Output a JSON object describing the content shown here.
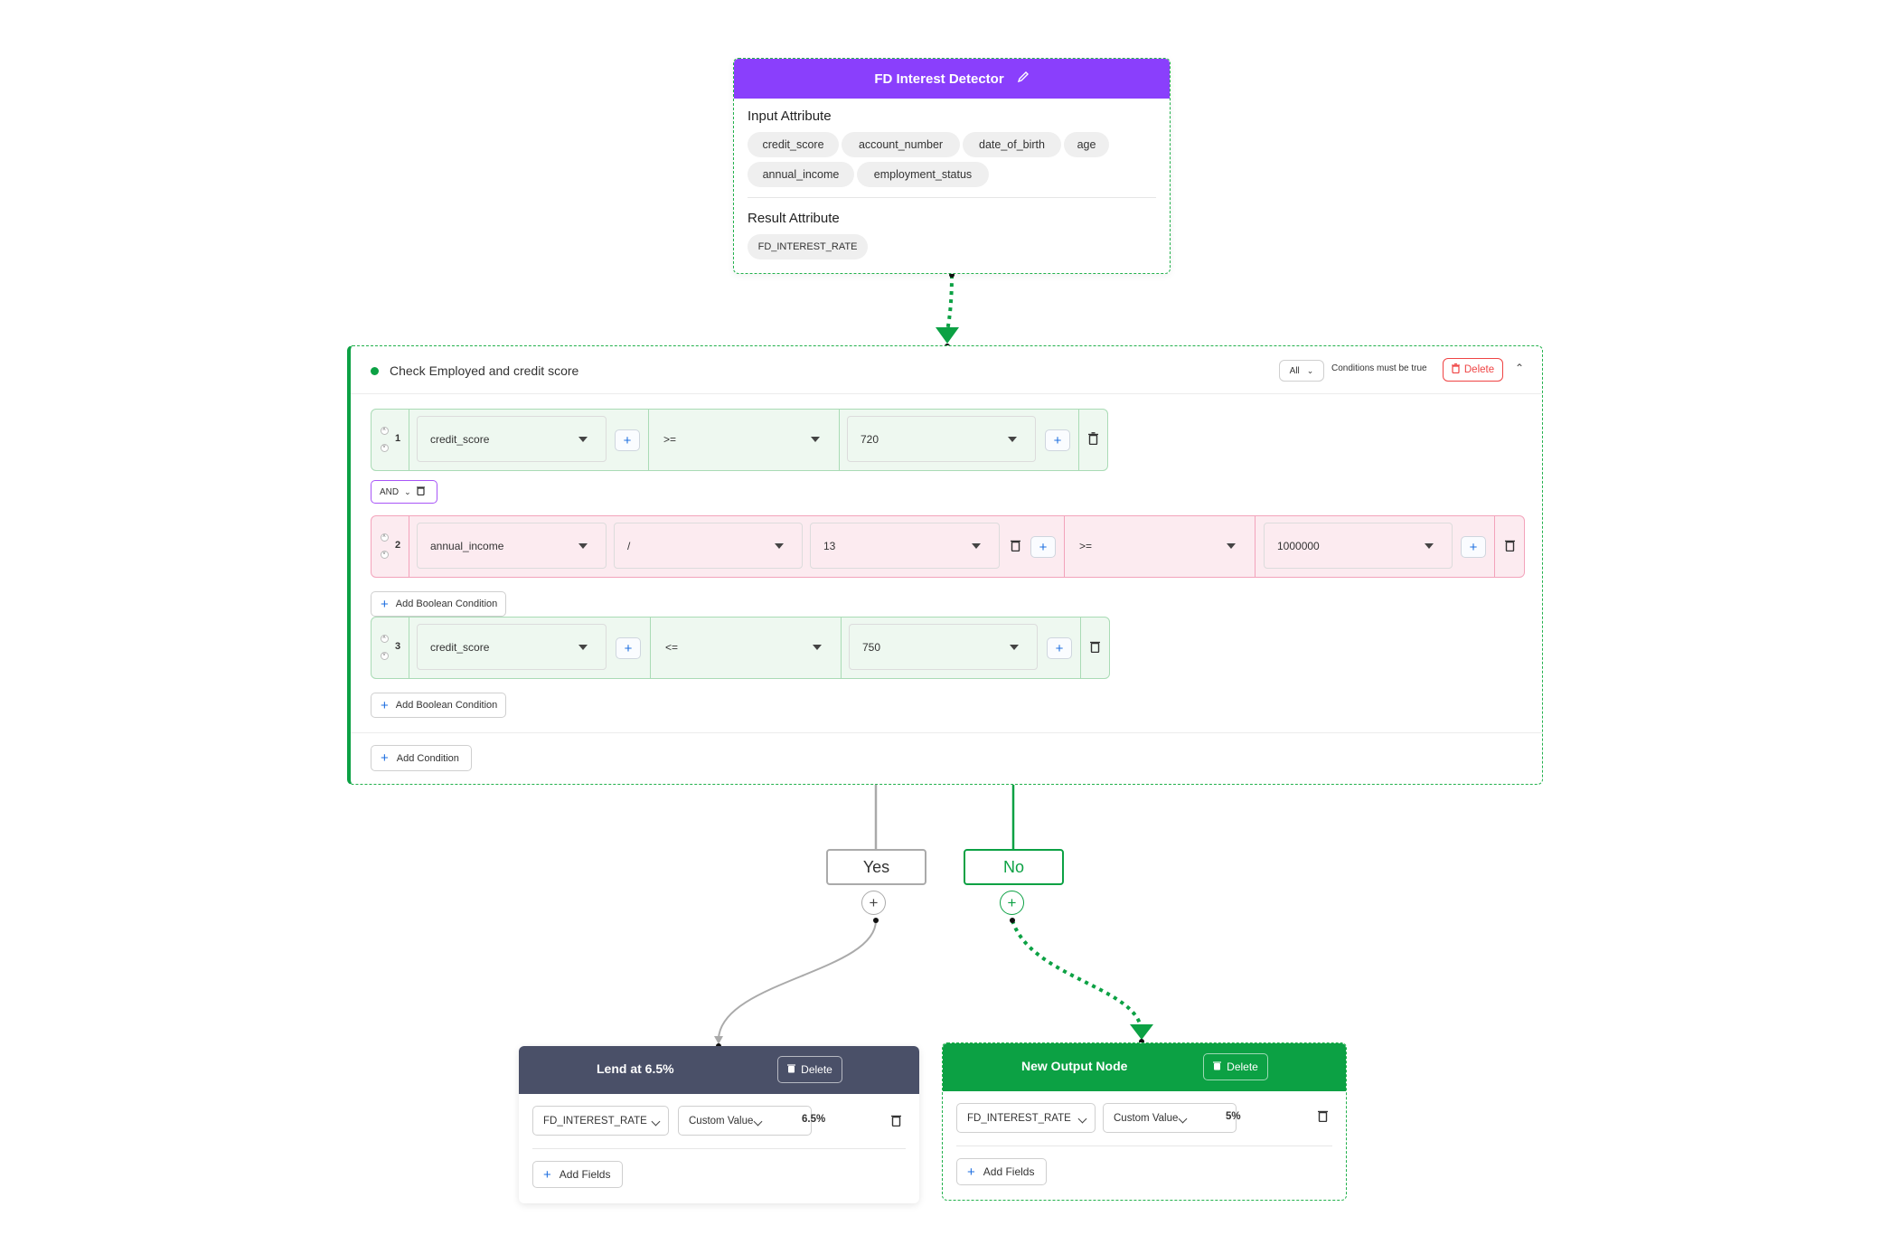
{
  "colors": {
    "accent_purple": "#8a3ffc",
    "success_green": "#0ca144",
    "danger_red": "#ef4444",
    "header_slate": "#4a5068",
    "link_blue": "#1e6fe0"
  },
  "top_node": {
    "title": "FD Interest Detector",
    "edit_icon": "pencil-icon",
    "input_label": "Input Attribute",
    "inputs": [
      "credit_score",
      "account_number",
      "date_of_birth",
      "age",
      "annual_income",
      "employment_status"
    ],
    "result_label": "Result Attribute",
    "results": [
      "FD_INTEREST_RATE"
    ]
  },
  "condition_node": {
    "title": "Check Employed and credit score",
    "match_mode": "All",
    "match_text": "Conditions must be true",
    "delete_label": "Delete",
    "collapse_icon": "chevron-up-icon",
    "rows": [
      {
        "num": "1",
        "field": "credit_score",
        "operator": ">=",
        "value": "720"
      },
      {
        "num": "2",
        "field": "annual_income",
        "math_op": "/",
        "math_value": "13",
        "operator": ">=",
        "value": "1000000"
      },
      {
        "num": "3",
        "field": "credit_score",
        "operator": "<=",
        "value": "750"
      }
    ],
    "connector": "AND",
    "add_boolean_label": "Add Boolean Condition",
    "add_condition_label": "Add Condition",
    "plus": "+"
  },
  "branches": {
    "yes_label": "Yes",
    "no_label": "No",
    "plus": "+"
  },
  "outputs": [
    {
      "title": "Lend at 6.5%",
      "delete_label": "Delete",
      "field": "FD_INTEREST_RATE",
      "value_type": "Custom Value",
      "value": "6.5%",
      "add_label": "Add Fields",
      "plus": "+"
    },
    {
      "title": "New Output Node",
      "delete_label": "Delete",
      "field": "FD_INTEREST_RATE",
      "value_type": "Custom Value",
      "value": "5%",
      "add_label": "Add Fields",
      "plus": "+"
    }
  ]
}
